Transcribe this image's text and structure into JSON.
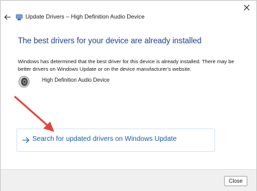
{
  "window": {
    "title": "Update Drivers – High Definition Audio Device",
    "close_icon": "close-x-icon"
  },
  "content": {
    "heading": "The best drivers for your device are already installed",
    "description": "Windows has determined that the best driver for this device is already installed. There may be better drivers on Windows Update or on the device manufacturer's website.",
    "device_name": "High Definition Audio Device",
    "device_icon": "speaker-icon",
    "search_link_label": "Search for updated drivers on Windows Update"
  },
  "footer": {
    "close_label": "Close"
  },
  "colors": {
    "heading": "#1a3c8f",
    "link": "#1c5aa6",
    "annotation_arrow": "#e0453a"
  }
}
